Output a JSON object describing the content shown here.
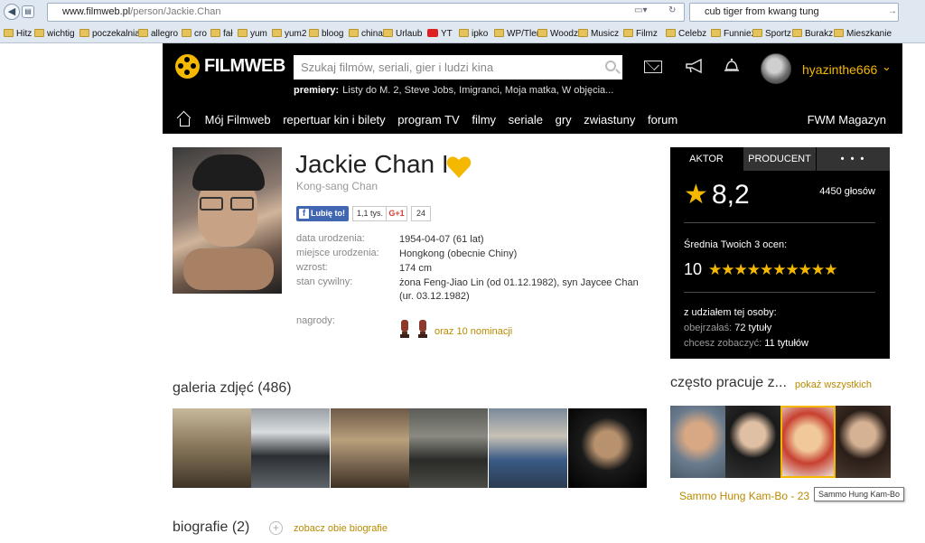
{
  "browser": {
    "url_domain": "www.filmweb.pl",
    "url_path": "/person/Jackie.Chan",
    "search_text": "cub tiger from kwang tung",
    "bookmarks": [
      "Hitz",
      "wichtig",
      "poczekalnia",
      "allegro",
      "cro",
      "fał",
      "yum",
      "yum2",
      "bloog",
      "china",
      "Urlaub",
      "YT",
      "ipko",
      "WP/Tlen",
      "Woodz",
      "Musicz",
      "Filmz",
      "Celebz",
      "Funniez",
      "Sportz",
      "Burakz",
      "Mieszkanie"
    ]
  },
  "header": {
    "logo_text": "FILMWEB",
    "search_placeholder": "Szukaj filmów, seriali, gier i ludzi kina",
    "premiery_label": "premiery:",
    "premiery_list": "Listy do M. 2, Steve Jobs, Imigranci, Moja matka, W objęcia...",
    "username": "hyazinthe666",
    "nav": [
      "Mój Filmweb",
      "repertuar kin i bilety",
      "program TV",
      "filmy",
      "seriale",
      "gry",
      "zwiastuny",
      "forum"
    ],
    "magazine": "FWM Magazyn"
  },
  "person": {
    "name": "Jackie Chan I",
    "original_name": "Kong-sang Chan",
    "fb_like": "Lubię to!",
    "fb_count": "1,1 tys.",
    "gplus": "G+1",
    "gplus_count": "24",
    "labels": {
      "birth_date": "data urodzenia:",
      "birth_place": "miejsce urodzenia:",
      "height": "wzrost:",
      "marital": "stan cywilny:",
      "awards": "nagrody:"
    },
    "birth_date": "1954-04-07 (61 lat)",
    "birth_place": "Hongkong (obecnie Chiny)",
    "height": "174 cm",
    "marital_1": "żona Feng-Jiao Lin (od 01.12.1982), syn Jaycee Chan",
    "marital_2": "(ur. 03.12.1982)",
    "nominations": "oraz 10 nominacji"
  },
  "rating": {
    "tabs": [
      "AKTOR",
      "PRODUCENT",
      "• • •"
    ],
    "score": "8,2",
    "votes": "4450 głosów",
    "avg_label": "Średnia Twoich 3 ocen:",
    "avg_value": "10",
    "avg_stars": "★★★★★★★★★★",
    "with_label": "z udziałem tej osoby:",
    "seen_label": "obejrzałaś:",
    "seen_value": "72 tytuły",
    "want_label": "chcesz zobaczyć:",
    "want_value": "11 tytułów"
  },
  "gallery": {
    "title": "galeria zdjęć (486)"
  },
  "works": {
    "title": "często pracuje z...",
    "show_all": "pokaż wszystkich",
    "person_name": "Sammo Hung Kam-Bo - 23",
    "tooltip": "Sammo Hung Kam-Bo"
  },
  "bio": {
    "title": "biografie (2)",
    "link": "zobacz obie biografie"
  },
  "colors": {
    "accent": "#f5b800",
    "link_gold": "#b98a00",
    "header_bg": "#000000"
  }
}
